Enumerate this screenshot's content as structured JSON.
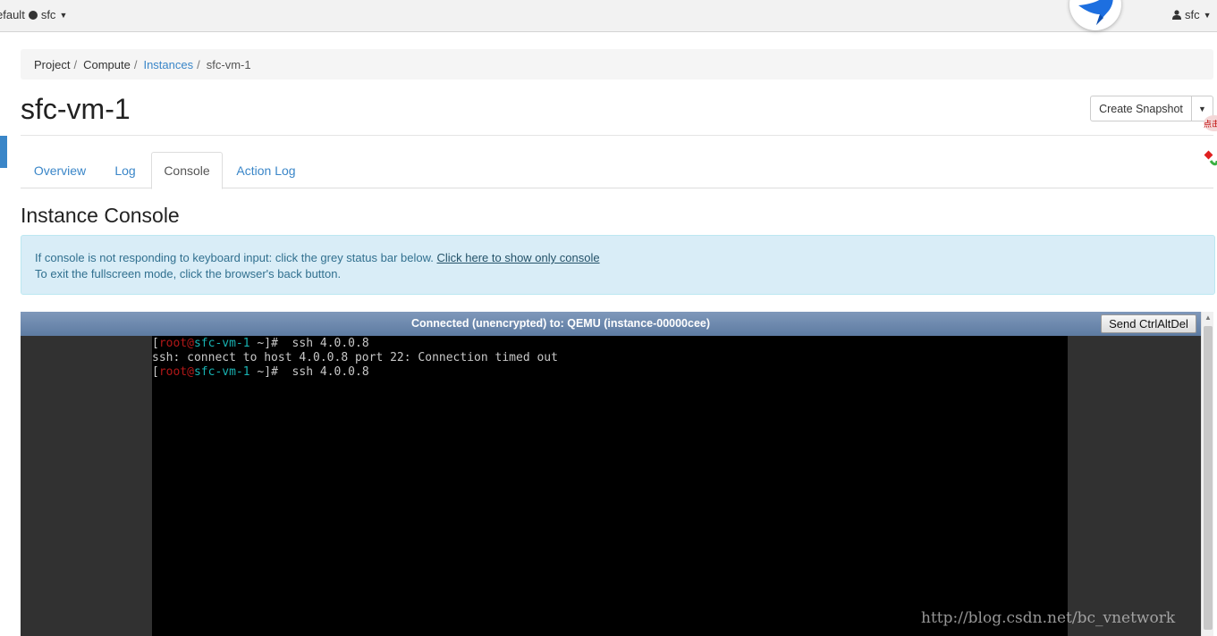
{
  "topbar": {
    "project_label": "efault",
    "project_name": "sfc",
    "user_name": "sfc"
  },
  "breadcrumb": {
    "items": [
      "Project",
      "Compute",
      "Instances",
      "sfc-vm-1"
    ]
  },
  "page": {
    "title": "sfc-vm-1",
    "snapshot_button": "Create Snapshot"
  },
  "tabs": [
    "Overview",
    "Log",
    "Console",
    "Action Log"
  ],
  "active_tab": "Console",
  "console_section": {
    "title": "Instance Console",
    "info_line1": "If console is not responding to keyboard input: click the grey status bar below. ",
    "info_link": "Click here to show only console",
    "info_line2": "To exit the fullscreen mode, click the browser's back button."
  },
  "vnc": {
    "status": "Connected (unencrypted) to: QEMU (instance-00000cee)",
    "send_button": "Send CtrlAltDel",
    "terminal": {
      "prompt_user": "root",
      "prompt_at": "@",
      "prompt_host": "sfc-vm-1",
      "prompt_dir": " ~",
      "line1_cmd": "  ssh 4.0.0.8",
      "line2": "ssh: connect to host 4.0.0.8 port 22: Connection timed out",
      "line3_cmd": "  ssh 4.0.0.8"
    }
  },
  "side_widget": {
    "text": "点击"
  },
  "watermark": "http://blog.csdn.net/bc_vnetwork",
  "colors": {
    "link": "#3a86c8",
    "status_bar": "#6b87ad",
    "info_bg": "#d9edf7",
    "terminal_red": "#b21818",
    "terminal_cyan": "#18b2b2"
  }
}
